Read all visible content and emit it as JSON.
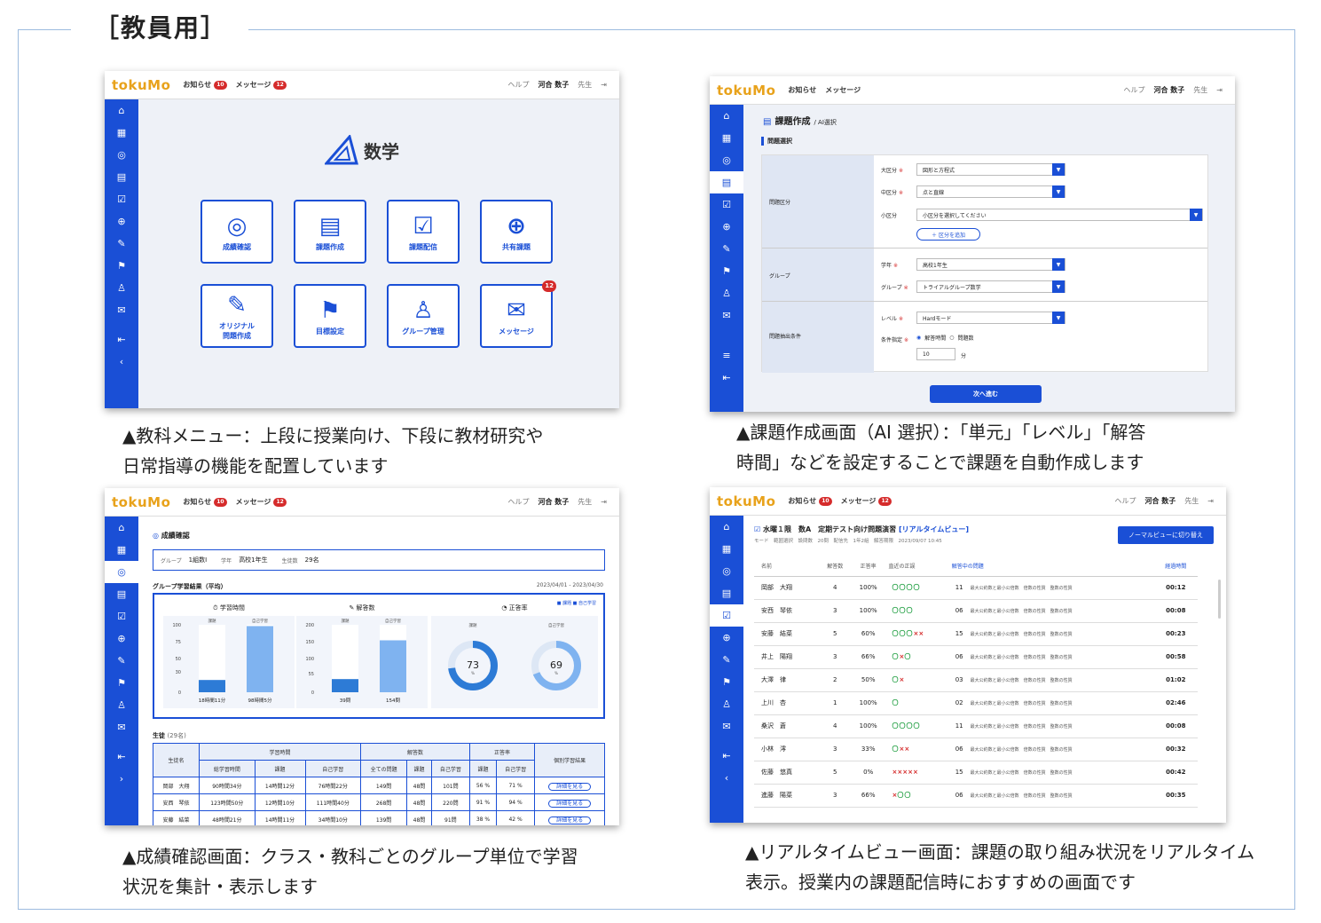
{
  "page_title": "［教員用］",
  "captions": {
    "c1_line1": "▲教科メニュー：上段に授業向け、下段に教材研究や",
    "c1_line2": "日常指導の機能を配置しています",
    "c2_line1": "▲課題作成画面（AI 選択）：「単元」「レベル」「解答",
    "c2_line2": "時間」などを設定することで課題を自動作成します",
    "c3_line1": "▲成績確認画面：クラス・教科ごとのグループ単位で学習",
    "c3_line2": "状況を集計・表示します",
    "c4_line1": "▲リアルタイムビュー画面：課題の取り組み状況をリアルタイム",
    "c4_line2": "表示。授業内の課題配信時におすすめの画面です"
  },
  "header": {
    "logo_pre": "toku",
    "logo_mid": "M",
    "logo_post": "o",
    "notice": "お知らせ",
    "notice_count": "10",
    "message": "メッセージ",
    "message_count": "12",
    "help": "ヘルプ",
    "user": "河合 数子",
    "user_suffix": "先生"
  },
  "screen1": {
    "subject": "数学",
    "tiles": [
      {
        "label": "成績確認",
        "icon": "◎"
      },
      {
        "label": "課題作成",
        "icon": "▤"
      },
      {
        "label": "課題配信",
        "icon": "☑"
      },
      {
        "label": "共有課題",
        "icon": "⊕"
      },
      {
        "label": "オリジナル\n問題作成",
        "icon": "✎"
      },
      {
        "label": "目標設定",
        "icon": "⚑"
      },
      {
        "label": "グループ管理",
        "icon": "♙"
      },
      {
        "label": "メッセージ",
        "icon": "✉",
        "badge": "12"
      }
    ]
  },
  "screen2": {
    "title": "課題作成",
    "crumb": "/ AI選択",
    "section": "問題選択",
    "row_labels": [
      "問題区分",
      "グループ",
      "問題抽出条件"
    ],
    "fields": {
      "daikubun": "大区分",
      "daikubun_val": "図形と方程式",
      "chukubun": "中区分",
      "chukubun_val": "点と直線",
      "shokubun": "小区分",
      "shokubun_val": "小区分を選択してください",
      "add": "＋ 区分を追加",
      "grade": "学年",
      "grade_val": "高校1年生",
      "group": "グループ",
      "group_val": "トライアルグループ数学",
      "level": "レベル",
      "level_val": "Hardモード",
      "cond": "条件指定",
      "radio1": "解答時間",
      "radio2": "問題数",
      "minutes_val": "10",
      "minutes_unit": "分"
    },
    "next": "次へ進む"
  },
  "screen3": {
    "title": "成績確認",
    "group_label": "グループ",
    "group_val": "1組数Ⅰ",
    "grade_label": "学年",
    "grade_val": "高校1年生",
    "count_label": "生徒数",
    "count_val": "29名",
    "section": "グループ学習結果（平均）",
    "range": "2023/04/01 - 2023/04/30",
    "legend": "■ 課題 ■ 自己学習",
    "cards": {
      "time": "学習時間",
      "answers": "解答数",
      "rate": "正答率"
    },
    "students_label": "生徒",
    "students_count": "(29名)",
    "table_headers": [
      "生徒名",
      "総学習時間",
      "課題",
      "自己学習",
      "全ての問題",
      "課題",
      "自己学習",
      "課題",
      "自己学習",
      "個別学習結果"
    ],
    "group_headers": [
      "学習時間",
      "解答数",
      "正答率"
    ],
    "rows": [
      [
        "岡部　大翔",
        "90時間34分",
        "14時間12分",
        "76時間22分",
        "149問",
        "48問",
        "101問",
        "56 %",
        "71 %",
        "詳細を見る"
      ],
      [
        "安西　琴依",
        "123時間50分",
        "12時間10分",
        "111時間40分",
        "268問",
        "48問",
        "220問",
        "91 %",
        "94 %",
        "詳細を見る"
      ],
      [
        "安藤　結菜",
        "48時間21分",
        "14時間11分",
        "34時間10分",
        "139問",
        "48問",
        "91問",
        "38 %",
        "42 %",
        "詳細を見る"
      ]
    ]
  },
  "screen4": {
    "title": "水曜１限　数A　定期テスト向け問題演習",
    "title_tag": "[リアルタイムビュー]",
    "sub": "モード　範囲選択　設問数　20問　配信先　1年2組　解答期限　2023/09/07 10:45",
    "switch": "ノーマルビューに切り替え",
    "headers": [
      "名前",
      "解答数",
      "正答率",
      "直近の正誤",
      "解答中の問題",
      "経過時間"
    ],
    "rows": [
      {
        "name": "岡部　大翔",
        "count": "4",
        "rate": "100%",
        "ok": "〇〇〇〇",
        "ng": "",
        "q": "11",
        "time": "00:12"
      },
      {
        "name": "安西　琴依",
        "count": "3",
        "rate": "100%",
        "ok": "〇〇〇",
        "ng": "",
        "q": "06",
        "time": "00:08"
      },
      {
        "name": "安藤　結菜",
        "count": "5",
        "rate": "60%",
        "ok": "〇〇〇",
        "ng": "××",
        "q": "15",
        "time": "00:23"
      },
      {
        "name": "井上　陽翔",
        "count": "3",
        "rate": "66%",
        "ok": "〇",
        "ng": "×",
        "ok2": "〇",
        "q": "06",
        "time": "00:58"
      },
      {
        "name": "大澤　律",
        "count": "2",
        "rate": "50%",
        "ok": "〇",
        "ng": "×",
        "q": "03",
        "time": "01:02"
      },
      {
        "name": "上川　杏",
        "count": "1",
        "rate": "100%",
        "ok": "〇",
        "ng": "",
        "q": "02",
        "time": "02:46"
      },
      {
        "name": "桑沢　蒼",
        "count": "4",
        "rate": "100%",
        "ok": "〇〇〇〇",
        "ng": "",
        "q": "11",
        "time": "00:08"
      },
      {
        "name": "小林　澪",
        "count": "3",
        "rate": "33%",
        "ok": "〇",
        "ng": "××",
        "q": "06",
        "time": "00:32"
      },
      {
        "name": "佐藤　悠真",
        "count": "5",
        "rate": "0%",
        "ok": "",
        "ng": "×××××",
        "q": "15",
        "time": "00:42"
      },
      {
        "name": "進藤　陽菜",
        "count": "3",
        "rate": "66%",
        "ok": "",
        "ng": "×",
        "ok2": "〇〇",
        "q": "06",
        "time": "00:35"
      }
    ],
    "q_text": "最大公約数と最小公倍数　倍数の性質　整数の性質"
  },
  "chart_data": [
    {
      "type": "bar",
      "title": "学習時間",
      "categories": [
        "課題",
        "自己学習"
      ],
      "values": [
        18.18,
        98.08
      ],
      "value_labels": [
        "18時間11分",
        "98時間5分"
      ],
      "ylim": [
        0,
        100
      ],
      "yticks": [
        0,
        30,
        50,
        75,
        100
      ]
    },
    {
      "type": "bar",
      "title": "解答数",
      "categories": [
        "課題",
        "自己学習"
      ],
      "values": [
        39,
        154
      ],
      "value_labels": [
        "39問",
        "154問"
      ],
      "ylim": [
        0,
        200
      ],
      "yticks": [
        0,
        55,
        100,
        150,
        200
      ]
    },
    {
      "type": "pie",
      "title": "正答率",
      "categories": [
        "課題",
        "自己学習"
      ],
      "values": [
        73,
        69
      ],
      "value_labels": [
        "73",
        "69"
      ],
      "unit": "%"
    }
  ],
  "colors": {
    "brand": "#1a4fd6",
    "accent": "#e8a21b",
    "ok": "#2aa34a",
    "ng": "#d52b2b",
    "light": "#7fb3f0"
  }
}
